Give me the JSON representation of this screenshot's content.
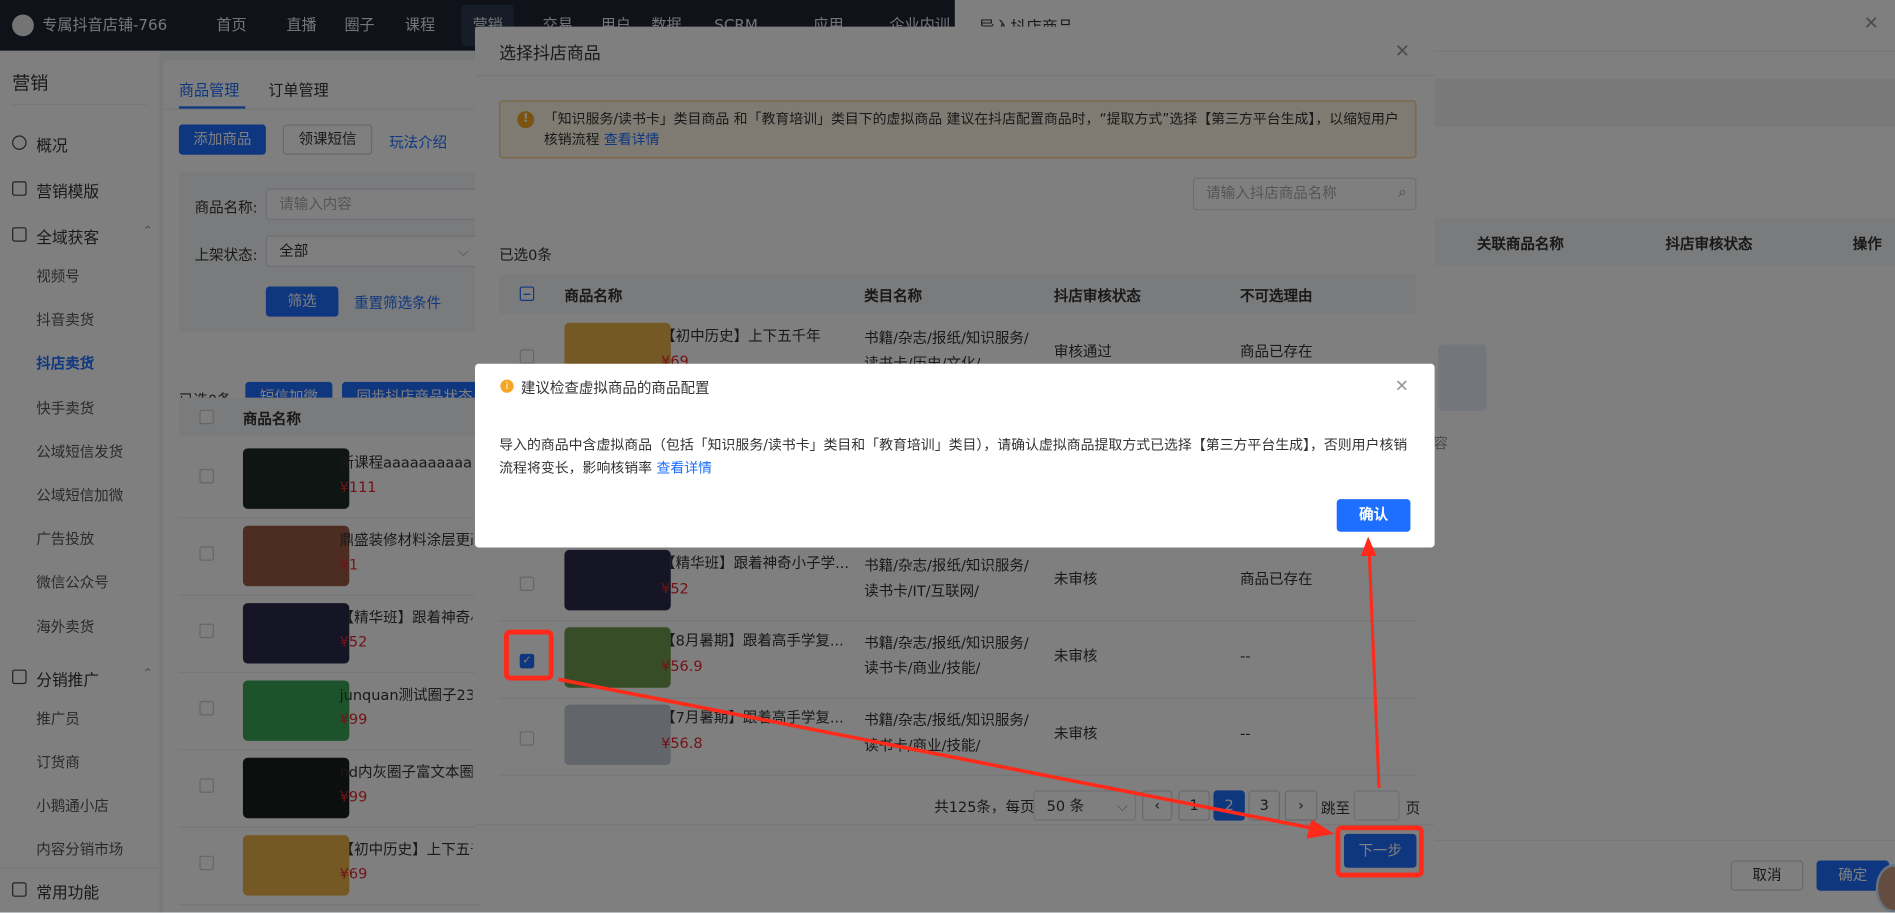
{
  "nav": {
    "brand": "专属抖音店铺-766",
    "items": [
      "首页",
      "直播",
      "圈子",
      "课程",
      "营销",
      "交易",
      "用户",
      "数据",
      "SCRM",
      "应用",
      "企业内训"
    ],
    "active": "营销"
  },
  "sidebar": {
    "title": "营销",
    "groups": [
      {
        "label": "概况",
        "icon": "pie-chart-icon"
      },
      {
        "label": "营销模版",
        "icon": "grid-icon"
      },
      {
        "label": "全域获客",
        "icon": "user-scan-icon",
        "children": [
          "视频号",
          "抖音卖货",
          "抖店卖货",
          "快手卖货",
          "公域短信发货",
          "公域短信加微",
          "广告投放",
          "微信公众号",
          "海外卖货"
        ]
      },
      {
        "label": "分销推广",
        "icon": "speaker-icon",
        "children": [
          "推广员",
          "订货商",
          "小鹅通小店",
          "内容分销市场"
        ]
      },
      {
        "label": "常用功能",
        "icon": "list-icon"
      }
    ],
    "active": "抖店卖货"
  },
  "main": {
    "tabs": [
      "商品管理",
      "订单管理"
    ],
    "active_tab": "商品管理",
    "add_button": "添加商品",
    "sms_button": "领课短信",
    "guide_link": "玩法介绍",
    "filter": {
      "name_label": "商品名称:",
      "name_placeholder": "请输入内容",
      "status_label": "上架状态:",
      "status_value": "全部",
      "filter_button": "筛选",
      "reset_link": "重置筛选条件"
    },
    "selected": "已选0条",
    "sms_wechat_button": "短信加微",
    "sync_button": "同步抖店商品状态",
    "table_header": "商品名称",
    "rows": [
      {
        "name": "新课程aaaaaaaaaaaa",
        "price": "¥111",
        "thumb": "#1f2a25"
      },
      {
        "name": "鼎盛装修材料涂层更改",
        "price": "¥1",
        "thumb": "#9a5a45"
      },
      {
        "name": "【精华班】跟着神奇小",
        "price": "¥52",
        "thumb": "#2d2a4a"
      },
      {
        "name": "junquan测试圈子231",
        "price": "¥99",
        "thumb": "#3aa655"
      },
      {
        "name": "hd内灰圈子富文本圈(",
        "price": "¥99",
        "thumb": "#1a1d1c"
      },
      {
        "name": "【初中历史】上下五千",
        "price": "¥69",
        "thumb": "#e8b24a"
      }
    ]
  },
  "drawer": {
    "title": "导入抖店商品",
    "columns": [
      "关联商品名称",
      "抖店审核状态",
      "操作"
    ],
    "empty_text": "暂无内容",
    "cancel": "取消",
    "confirm": "确定"
  },
  "modal": {
    "title": "选择抖店商品",
    "alert": {
      "text": "「知识服务/读书卡」类目商品 和「教育培训」类目下的虚拟商品 建议在抖店配置商品时，“提取方式”选择【第三方平台生成】，以缩短用户核销流程",
      "link": "查看详情"
    },
    "search_placeholder": "请输入抖店商品名称",
    "selected": "已选0条",
    "columns": [
      "商品名称",
      "类目名称",
      "抖店审核状态",
      "不可选理由"
    ],
    "rows": [
      {
        "name": "【初中历史】上下五千年",
        "price": "¥69",
        "category": "书籍/杂志/报纸/知识服务/读书卡/历史/文化/",
        "status": "审核通过",
        "reason": "商品已存在",
        "checked": false,
        "thumb": "#e8b24a"
      },
      {
        "name": "【精华班】跟着神奇小子学...",
        "price": "¥52",
        "category": "书籍/杂志/报纸/知识服务/读书卡/IT/互联网/",
        "status": "未审核",
        "reason": "商品已存在",
        "checked": false,
        "thumb": "#2d2a4a"
      },
      {
        "name": "【8月暑期】跟着高手学复...",
        "price": "¥56.9",
        "category": "书籍/杂志/报纸/知识服务/读书卡/商业/技能/",
        "status": "未审核",
        "reason": "--",
        "checked": true,
        "thumb": "#6f9a4e"
      },
      {
        "name": "【7月暑期】跟着高手学复...",
        "price": "¥56.8",
        "category": "书籍/杂志/报纸/知识服务/读书卡/商业/技能/",
        "status": "未审核",
        "reason": "--",
        "checked": false,
        "thumb": "#c5cad3"
      }
    ],
    "pagination": {
      "total": "共125条，每页",
      "page_size": "50 条",
      "pages": [
        "1",
        "2",
        "3"
      ],
      "current": "2",
      "jump_label": "跳至",
      "page_unit": "页"
    },
    "next_button": "下一步"
  },
  "dialog": {
    "title": "建议检查虚拟商品的商品配置",
    "body": "导入的商品中含虚拟商品（包括「知识服务/读书卡」类目和「教育培训」类目），请确认虚拟商品提取方式已选择【第三方平台生成】，否则用户核销流程将变长，影响核销率",
    "link": "查看详情",
    "confirm": "确认"
  },
  "colors": {
    "primary": "#1e6fff",
    "price": "#e5262e",
    "warning": "#f5a623",
    "annotation": "#ff2a1a"
  }
}
